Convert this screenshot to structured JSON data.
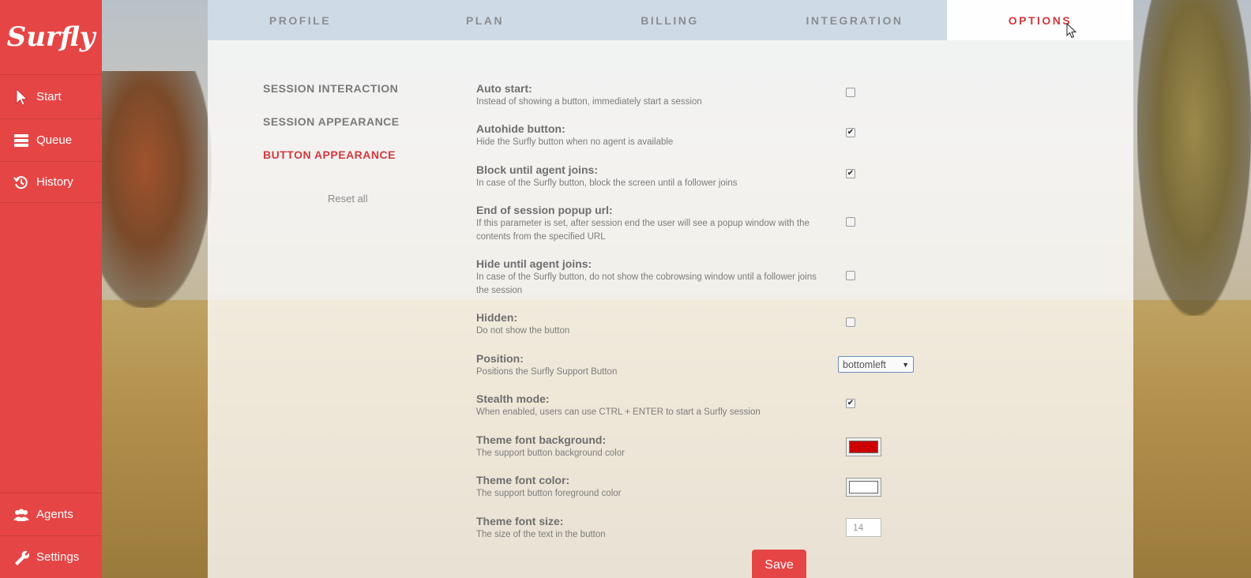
{
  "app": {
    "logo": "Surfly"
  },
  "sidebar": {
    "items": [
      {
        "label": "Start",
        "icon": "pointer-icon"
      },
      {
        "label": "Queue",
        "icon": "queue-icon"
      },
      {
        "label": "History",
        "icon": "history-icon"
      }
    ],
    "bottom_items": [
      {
        "label": "Agents",
        "icon": "agents-icon"
      },
      {
        "label": "Settings",
        "icon": "wrench-icon"
      }
    ]
  },
  "tabs": [
    {
      "label": "PROFILE"
    },
    {
      "label": "PLAN"
    },
    {
      "label": "BILLING"
    },
    {
      "label": "INTEGRATION"
    },
    {
      "label": "OPTIONS",
      "active": true
    }
  ],
  "subnav": {
    "items": [
      {
        "label": "SESSION INTERACTION"
      },
      {
        "label": "SESSION APPEARANCE"
      },
      {
        "label": "BUTTON APPEARANCE",
        "active": true
      }
    ],
    "reset_label": "Reset all"
  },
  "options": [
    {
      "title": "Auto start:",
      "desc": "Instead of showing a button, immediately start a session",
      "control": "checkbox",
      "checked": false
    },
    {
      "title": "Autohide button:",
      "desc": "Hide the Surfly button when no agent is available",
      "control": "checkbox",
      "checked": true
    },
    {
      "title": "Block until agent joins:",
      "desc": "In case of the Surfly button, block the screen until a follower joins",
      "control": "checkbox",
      "checked": true
    },
    {
      "title": "End of session popup url:",
      "desc": "If this parameter is set, after session end the user will see a popup window with the contents from the specified URL",
      "control": "checkbox",
      "checked": false
    },
    {
      "title": "Hide until agent joins:",
      "desc": "In case of the Surfly button, do not show the cobrowsing window until a follower joins the session",
      "control": "checkbox",
      "checked": false
    },
    {
      "title": "Hidden:",
      "desc": "Do not show the button",
      "control": "checkbox",
      "checked": false
    },
    {
      "title": "Position:",
      "desc": "Positions the Surfly Support Button",
      "control": "select",
      "value": "bottomleft"
    },
    {
      "title": "Stealth mode:",
      "desc": "When enabled, users can use CTRL + ENTER to start a Surfly session",
      "control": "checkbox",
      "checked": true
    },
    {
      "title": "Theme font background:",
      "desc": "The support button background color",
      "control": "color",
      "value": "#cc0000"
    },
    {
      "title": "Theme font color:",
      "desc": "The support button foreground color",
      "control": "color",
      "value": "#ffffff"
    },
    {
      "title": "Theme font size:",
      "desc": "The size of the text in the button",
      "control": "number",
      "value": "14"
    }
  ],
  "save_label": "Save",
  "colors": {
    "accent": "#e64545",
    "active_text": "#d2383e"
  },
  "checkmark": "✔",
  "select_arrow": "▼"
}
